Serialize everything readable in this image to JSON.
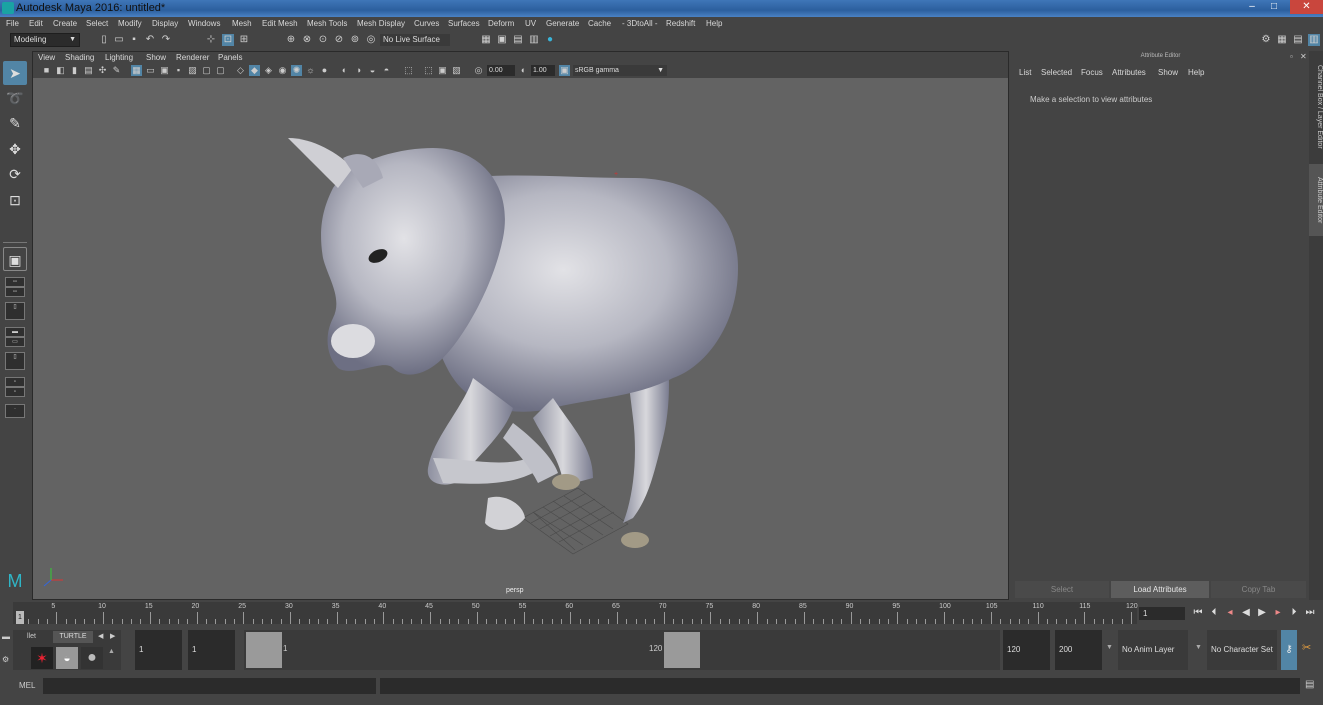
{
  "window": {
    "title": "Autodesk Maya 2016: untitled*",
    "min": "–",
    "max": "□",
    "close": "✕"
  },
  "menubar": [
    "File",
    "Edit",
    "Create",
    "Select",
    "Modify",
    "Display",
    "Windows",
    "Mesh",
    "Edit Mesh",
    "Mesh Tools",
    "Mesh Display",
    "Curves",
    "Surfaces",
    "Deform",
    "UV",
    "Generate",
    "Cache",
    "- 3DtoAll -",
    "Redshift",
    "Help"
  ],
  "statusline": {
    "menuset": "Modeling",
    "live_surface": "No Live Surface"
  },
  "viewport": {
    "menus": [
      "View",
      "Shading",
      "Lighting",
      "Show",
      "Renderer",
      "Panels"
    ],
    "exposure": "0.00",
    "gamma": "1.00",
    "color_space": "sRGB gamma",
    "camera_label": "persp"
  },
  "attribute_editor": {
    "header": "Attribute Editor",
    "menus": [
      "List",
      "Selected",
      "Focus",
      "Attributes",
      "Show",
      "Help"
    ],
    "message": "Make a selection to view attributes",
    "buttons": {
      "select": "Select",
      "load": "Load Attributes",
      "copy": "Copy Tab"
    }
  },
  "side_tabs": {
    "channel_box": "Channel Box / Layer Editor",
    "attribute_editor": "Attribute Editor"
  },
  "time_slider": {
    "ticks": [
      "1",
      "5",
      "10",
      "15",
      "20",
      "25",
      "30",
      "35",
      "40",
      "45",
      "50",
      "55",
      "60",
      "65",
      "70",
      "75",
      "80",
      "85",
      "90",
      "95",
      "100",
      "105",
      "110",
      "115",
      "120"
    ],
    "current_frame": "1"
  },
  "range_slider": {
    "start": "1",
    "playback_start": "1",
    "range_start_label": "1",
    "range_end_label": "120",
    "playback_end": "120",
    "end": "200",
    "anim_layer": "No Anim Layer",
    "character_set": "No Character Set"
  },
  "shelf": {
    "tab_partial": "llet",
    "tab_turtle": "TURTLE"
  },
  "command_line": {
    "language": "MEL"
  },
  "colors": {
    "accent": "#5285a6",
    "viewport_bg": "#636363",
    "panel_bg": "#444444"
  }
}
